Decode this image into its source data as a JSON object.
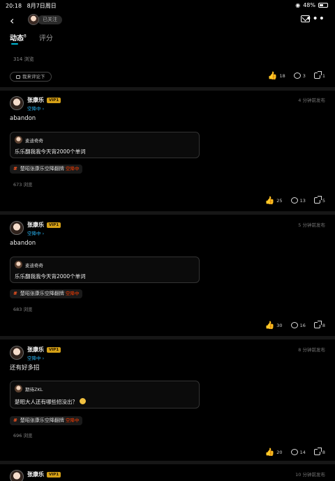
{
  "status": {
    "time": "20:18",
    "date": "8月7日周日",
    "wifi": "◉",
    "battery": "48%"
  },
  "nav": {
    "follow_label": "已关注",
    "back": "‹",
    "more": "•••"
  },
  "tabs": [
    {
      "label": "动态",
      "count": "8"
    },
    {
      "label": "评分"
    }
  ],
  "top_card": {
    "views": "314 浏览",
    "reply_label": "我来评论下",
    "likes": "18",
    "comments": "3",
    "shares": "1"
  },
  "posts": [
    {
      "name": "张康乐",
      "vip": "VIP1",
      "status": "空降中",
      "time": "4 分钟前发布",
      "text": "abandon",
      "quote_name": "麦迪奇奇",
      "quote_text": "乐乐翻我我今天背2000个单词",
      "topic": "楚昭张康乐空降翻牌",
      "topic_tag": "空降中",
      "views": "673 浏览",
      "likes": "25",
      "comments": "13",
      "shares": "5"
    },
    {
      "name": "张康乐",
      "vip": "VIP1",
      "status": "空降中",
      "time": "5 分钟前发布",
      "text": "abandon",
      "quote_name": "麦迪奇奇",
      "quote_text": "乐乐翻我我今天背2000个单词",
      "topic": "楚昭张康乐空降翻牌",
      "topic_tag": "空降中",
      "views": "683 浏览",
      "likes": "30",
      "comments": "16",
      "shares": "8"
    },
    {
      "name": "张康乐",
      "vip": "VIP1",
      "status": "空降中",
      "time": "8 分钟前发布",
      "text": "还有好多招",
      "quote_name": "期待ZKL",
      "quote_text": "楚昭大人还有哪些招没出？",
      "topic": "楚昭张康乐空降翻牌",
      "topic_tag": "空降中",
      "views": "696 浏览",
      "likes": "20",
      "comments": "14",
      "shares": "8"
    },
    {
      "name": "张康乐",
      "vip": "VIP1",
      "time": "10 分钟前发布"
    }
  ]
}
